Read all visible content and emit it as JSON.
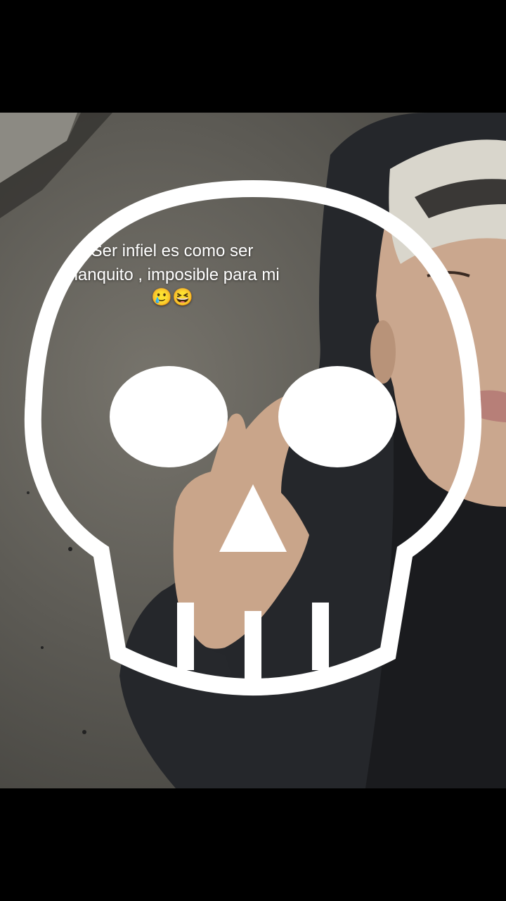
{
  "caption": {
    "line1": "Ser infiel es como ser",
    "line2": "blanquito , imposible para mi",
    "emojis": "🥲😆"
  },
  "stickers": {
    "tongue_emoji": "😛",
    "skull_icon": "skull-icon"
  },
  "colors": {
    "background": "#000000",
    "caption_text": "#ffffff"
  }
}
